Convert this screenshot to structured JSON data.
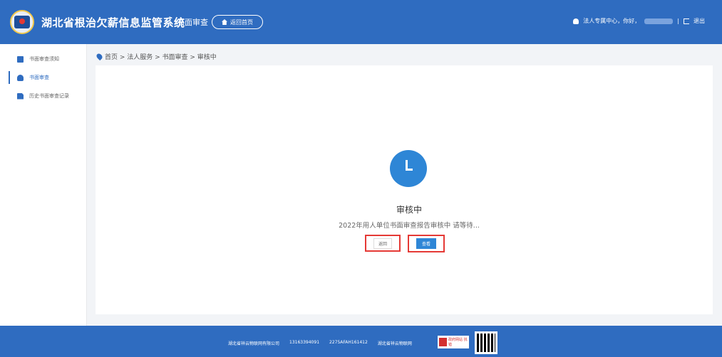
{
  "header": {
    "system_title": "湖北省根治欠薪信息监管系统",
    "separator": "|",
    "module_name": "书面审查",
    "home_button": "返回首页",
    "user_label": "法人专属中心，你好，",
    "logout_label": "退出"
  },
  "sidebar": {
    "items": [
      {
        "label": "书面审查须知",
        "icon": "book-icon"
      },
      {
        "label": "书面审查",
        "icon": "person-icon"
      },
      {
        "label": "历史书面审查记录",
        "icon": "document-icon"
      }
    ]
  },
  "breadcrumb": {
    "text": "首页 > 法人服务 > 书面审查 > 审核中"
  },
  "status": {
    "title": "审核中",
    "description": "2022年用人单位书面审查报告审核中 请等待...",
    "back_button": "返回",
    "view_button": "查看"
  },
  "footer": {
    "company": "湖北省祥云物联网有限公司",
    "phone": "13163394091",
    "qq": "2275AFAH161412",
    "slogan": "湖北省祥云物联网",
    "badge_text": "政府网站 找错"
  },
  "colors": {
    "header_bg": "#2f6cc0",
    "accent": "#2e86d6",
    "highlight": "#e53935"
  }
}
